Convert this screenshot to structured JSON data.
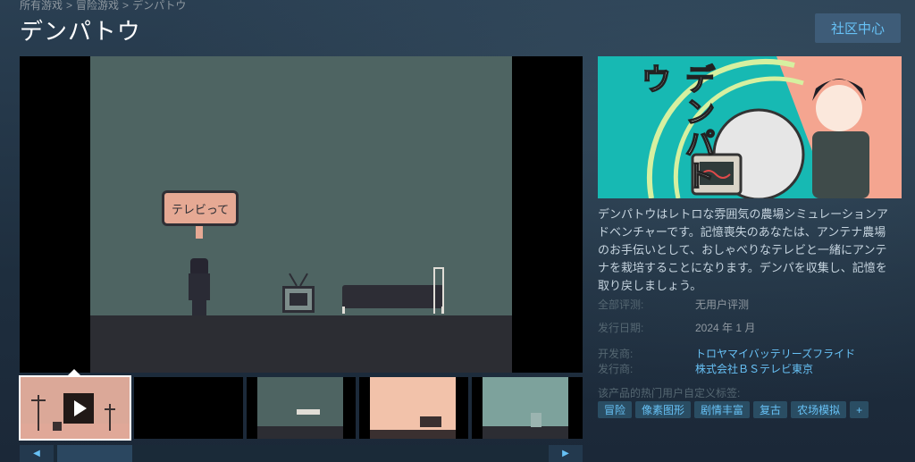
{
  "breadcrumb": {
    "items": [
      "所有游戏",
      "冒险游戏",
      "デンパトウ"
    ],
    "separator": ">"
  },
  "title": "デンパトウ",
  "community_button": "社区中心",
  "main_media": {
    "speech_bubble": "テレビって"
  },
  "thumbnails": {
    "count": 5,
    "active_index": 0,
    "first_is_video": true
  },
  "capsule": {
    "logo_text": "デンパトウ"
  },
  "description": "デンパトウはレトロな雰囲気の農場シミュレーションアドベンチャーです。記憶喪失のあなたは、アンテナ農場のお手伝いとして、おしゃべりなテレビと一緒にアンテナを栽培することになります。デンパを収集し、記憶を取り戻しましょう。",
  "info": {
    "reviews_label": "全部评测:",
    "reviews_value": "无用户评测",
    "release_label": "发行日期:",
    "release_value": "2024 年 1 月",
    "developer_label": "开发商:",
    "developer_value": "トロヤマイバッテリーズフライド",
    "publisher_label": "发行商:",
    "publisher_value": "株式会社ＢＳテレビ東京"
  },
  "tags_label": "该产品的热门用户自定义标签:",
  "tags": [
    "冒险",
    "像素图形",
    "剧情丰富",
    "复古",
    "农场模拟",
    "+"
  ],
  "colors": {
    "background": "#1b2838",
    "link": "#67c1f5",
    "tag_bg": "#2a4d63",
    "capsule_teal": "#17b9b3"
  }
}
